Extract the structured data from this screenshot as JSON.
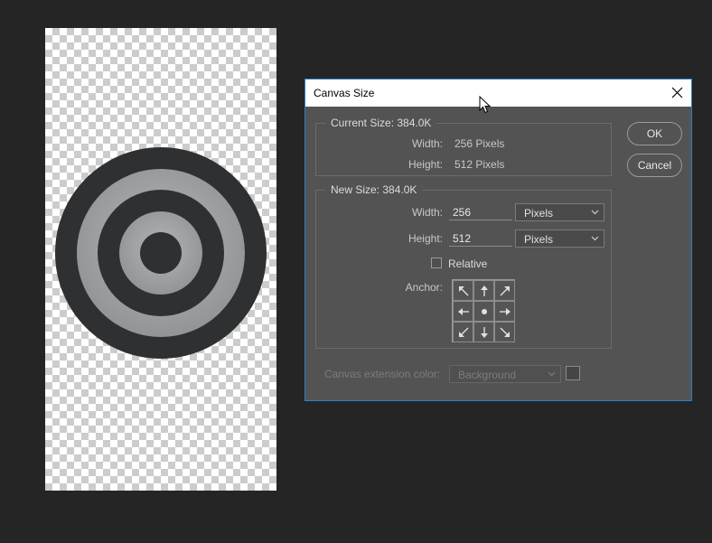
{
  "dialog": {
    "title": "Canvas Size",
    "current_size": {
      "legend": "Current Size: 384.0K",
      "width_label": "Width:",
      "width_value": "256 Pixels",
      "height_label": "Height:",
      "height_value": "512 Pixels"
    },
    "new_size": {
      "legend": "New Size: 384.0K",
      "width_label": "Width:",
      "width_value": "256",
      "width_unit": "Pixels",
      "height_label": "Height:",
      "height_value": "512",
      "height_unit": "Pixels",
      "relative_label": "Relative",
      "relative_checked": false,
      "anchor_label": "Anchor:"
    },
    "buttons": {
      "ok": "OK",
      "cancel": "Cancel"
    },
    "extension": {
      "label": "Canvas extension color:",
      "value": "Background"
    }
  },
  "colors": {
    "workspace": "#252525",
    "dialog_bg": "#535353",
    "dialog_border": "#2f7fd0",
    "target_dark": "#2f3031",
    "target_light": "#9d9fa1"
  },
  "icons": {
    "close": "close-icon",
    "chevron": "chevron-down-icon",
    "anchor_arrows": [
      "arrow-up-left-icon",
      "arrow-up-icon",
      "arrow-up-right-icon",
      "arrow-left-icon",
      "center-dot-icon",
      "arrow-right-icon",
      "arrow-down-left-icon",
      "arrow-down-icon",
      "arrow-down-right-icon"
    ]
  }
}
